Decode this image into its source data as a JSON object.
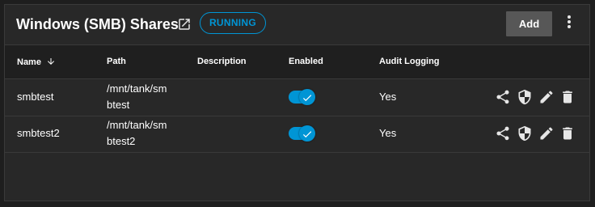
{
  "header": {
    "title": "Windows (SMB) Shares",
    "status": "RUNNING",
    "add_label": "Add"
  },
  "columns": {
    "name": "Name",
    "path": "Path",
    "description": "Description",
    "enabled": "Enabled",
    "audit": "Audit Logging"
  },
  "rows": [
    {
      "name": "smbtest",
      "path_line1": "/mnt/tank/sm",
      "path_line2": "btest",
      "description": "",
      "enabled": true,
      "audit": "Yes"
    },
    {
      "name": "smbtest2",
      "path_line1": "/mnt/tank/sm",
      "path_line2": "btest2",
      "description": "",
      "enabled": true,
      "audit": "Yes"
    }
  ],
  "colors": {
    "accent": "#0095d5",
    "background": "#282828",
    "header_row": "#1f1f1f"
  },
  "icons": [
    "open-in-new-icon",
    "more-vert-icon",
    "arrow-down-icon",
    "share-icon",
    "security-icon",
    "edit-icon",
    "delete-icon",
    "check-icon"
  ]
}
